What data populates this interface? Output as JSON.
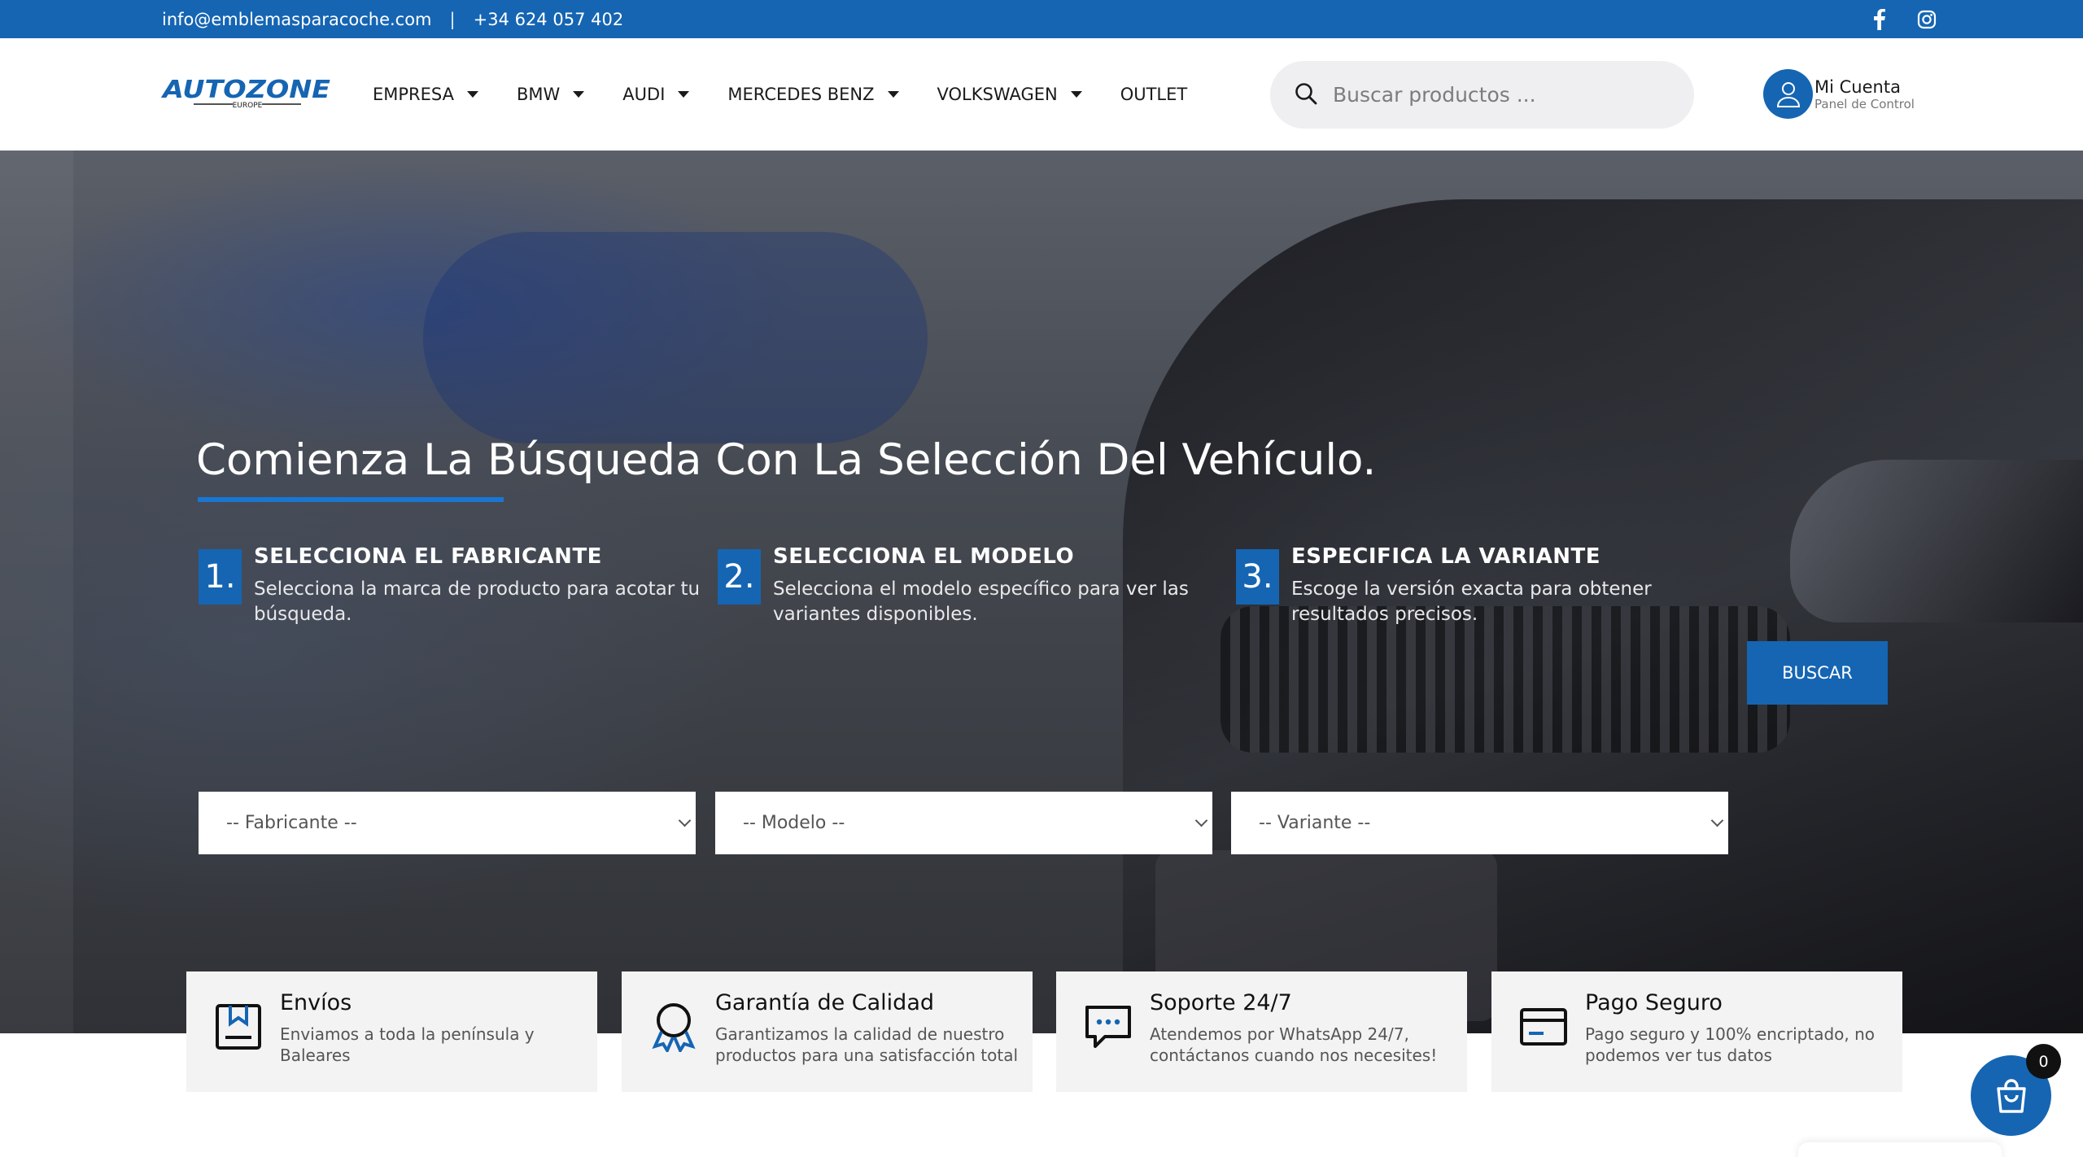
{
  "topbar": {
    "email": "info@emblemasparacoche.com",
    "separator": "|",
    "phone": "+34 624 057 402",
    "social": [
      "facebook-icon",
      "instagram-icon"
    ]
  },
  "header": {
    "logo_text": "AUTOZONE",
    "logo_sub": "EUROPE",
    "nav": [
      {
        "label": "EMPRESA",
        "dropdown": true
      },
      {
        "label": "BMW",
        "dropdown": true
      },
      {
        "label": "AUDI",
        "dropdown": true
      },
      {
        "label": "MERCEDES BENZ",
        "dropdown": true
      },
      {
        "label": "VOLKSWAGEN",
        "dropdown": true
      },
      {
        "label": "OUTLET",
        "dropdown": false
      }
    ],
    "search_placeholder": "Buscar productos ...",
    "account_title": "Mi Cuenta",
    "account_sub": "Panel de Control"
  },
  "hero": {
    "title_light": "Comienza La Búsqueda",
    "title_bold": "Con La Selección Del Vehículo.",
    "steps": [
      {
        "num": "1.",
        "head": "SELECCIONA EL FABRICANTE",
        "desc": "Selecciona la marca de producto para acotar tu búsqueda."
      },
      {
        "num": "2.",
        "head": "SELECCIONA EL MODELO",
        "desc": "Selecciona el modelo específico para ver las variantes disponibles."
      },
      {
        "num": "3.",
        "head": "ESPECIFICA LA VARIANTE",
        "desc": "Escoge la versión exacta para obtener resultados precisos."
      }
    ],
    "selects": [
      "-- Fabricante --",
      "-- Modelo --",
      "-- Variante --"
    ],
    "button": "BUSCAR"
  },
  "features": [
    {
      "icon": "box-icon",
      "title": "Envíos",
      "desc": "Enviamos a toda la península y Baleares"
    },
    {
      "icon": "award-icon",
      "title": "Garantía de Calidad",
      "desc": "Garantizamos la calidad de nuestro productos para una satisfacción total"
    },
    {
      "icon": "chat-icon",
      "title": "Soporte 24/7",
      "desc": "Atendemos por WhatsApp 24/7, contáctanos cuando nos necesites!"
    },
    {
      "icon": "credit-card-icon",
      "title": "Pago Seguro",
      "desc": "Pago seguro y 100% encriptado, no podemos ver tus datos"
    }
  ],
  "cart": {
    "count": "0"
  },
  "colors": {
    "brand": "#1565b3",
    "accent": "#1976d2"
  }
}
